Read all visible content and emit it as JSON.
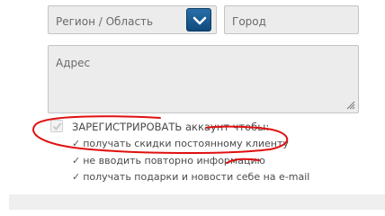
{
  "region": {
    "placeholder": "Регион / Область"
  },
  "city": {
    "placeholder": "Город"
  },
  "address": {
    "placeholder": "Адрес"
  },
  "register": {
    "checked": true,
    "label": "ЗАРЕГИСТРИРОВАТЬ аккаунт чтобы:",
    "benefits": [
      "получать скидки постоянному клиенту",
      "не вводить повторно информацию",
      "получать подарки и новости себе на e-mail"
    ],
    "check_glyph": "✓"
  },
  "colors": {
    "field_bg": "#ececec",
    "button_blue": "#1b5a91",
    "annotation_red": "#e01010"
  },
  "icons": {
    "dropdown": "chevron-down-icon",
    "resize": "resize-grip-icon",
    "checkmark": "checkmark-icon"
  }
}
